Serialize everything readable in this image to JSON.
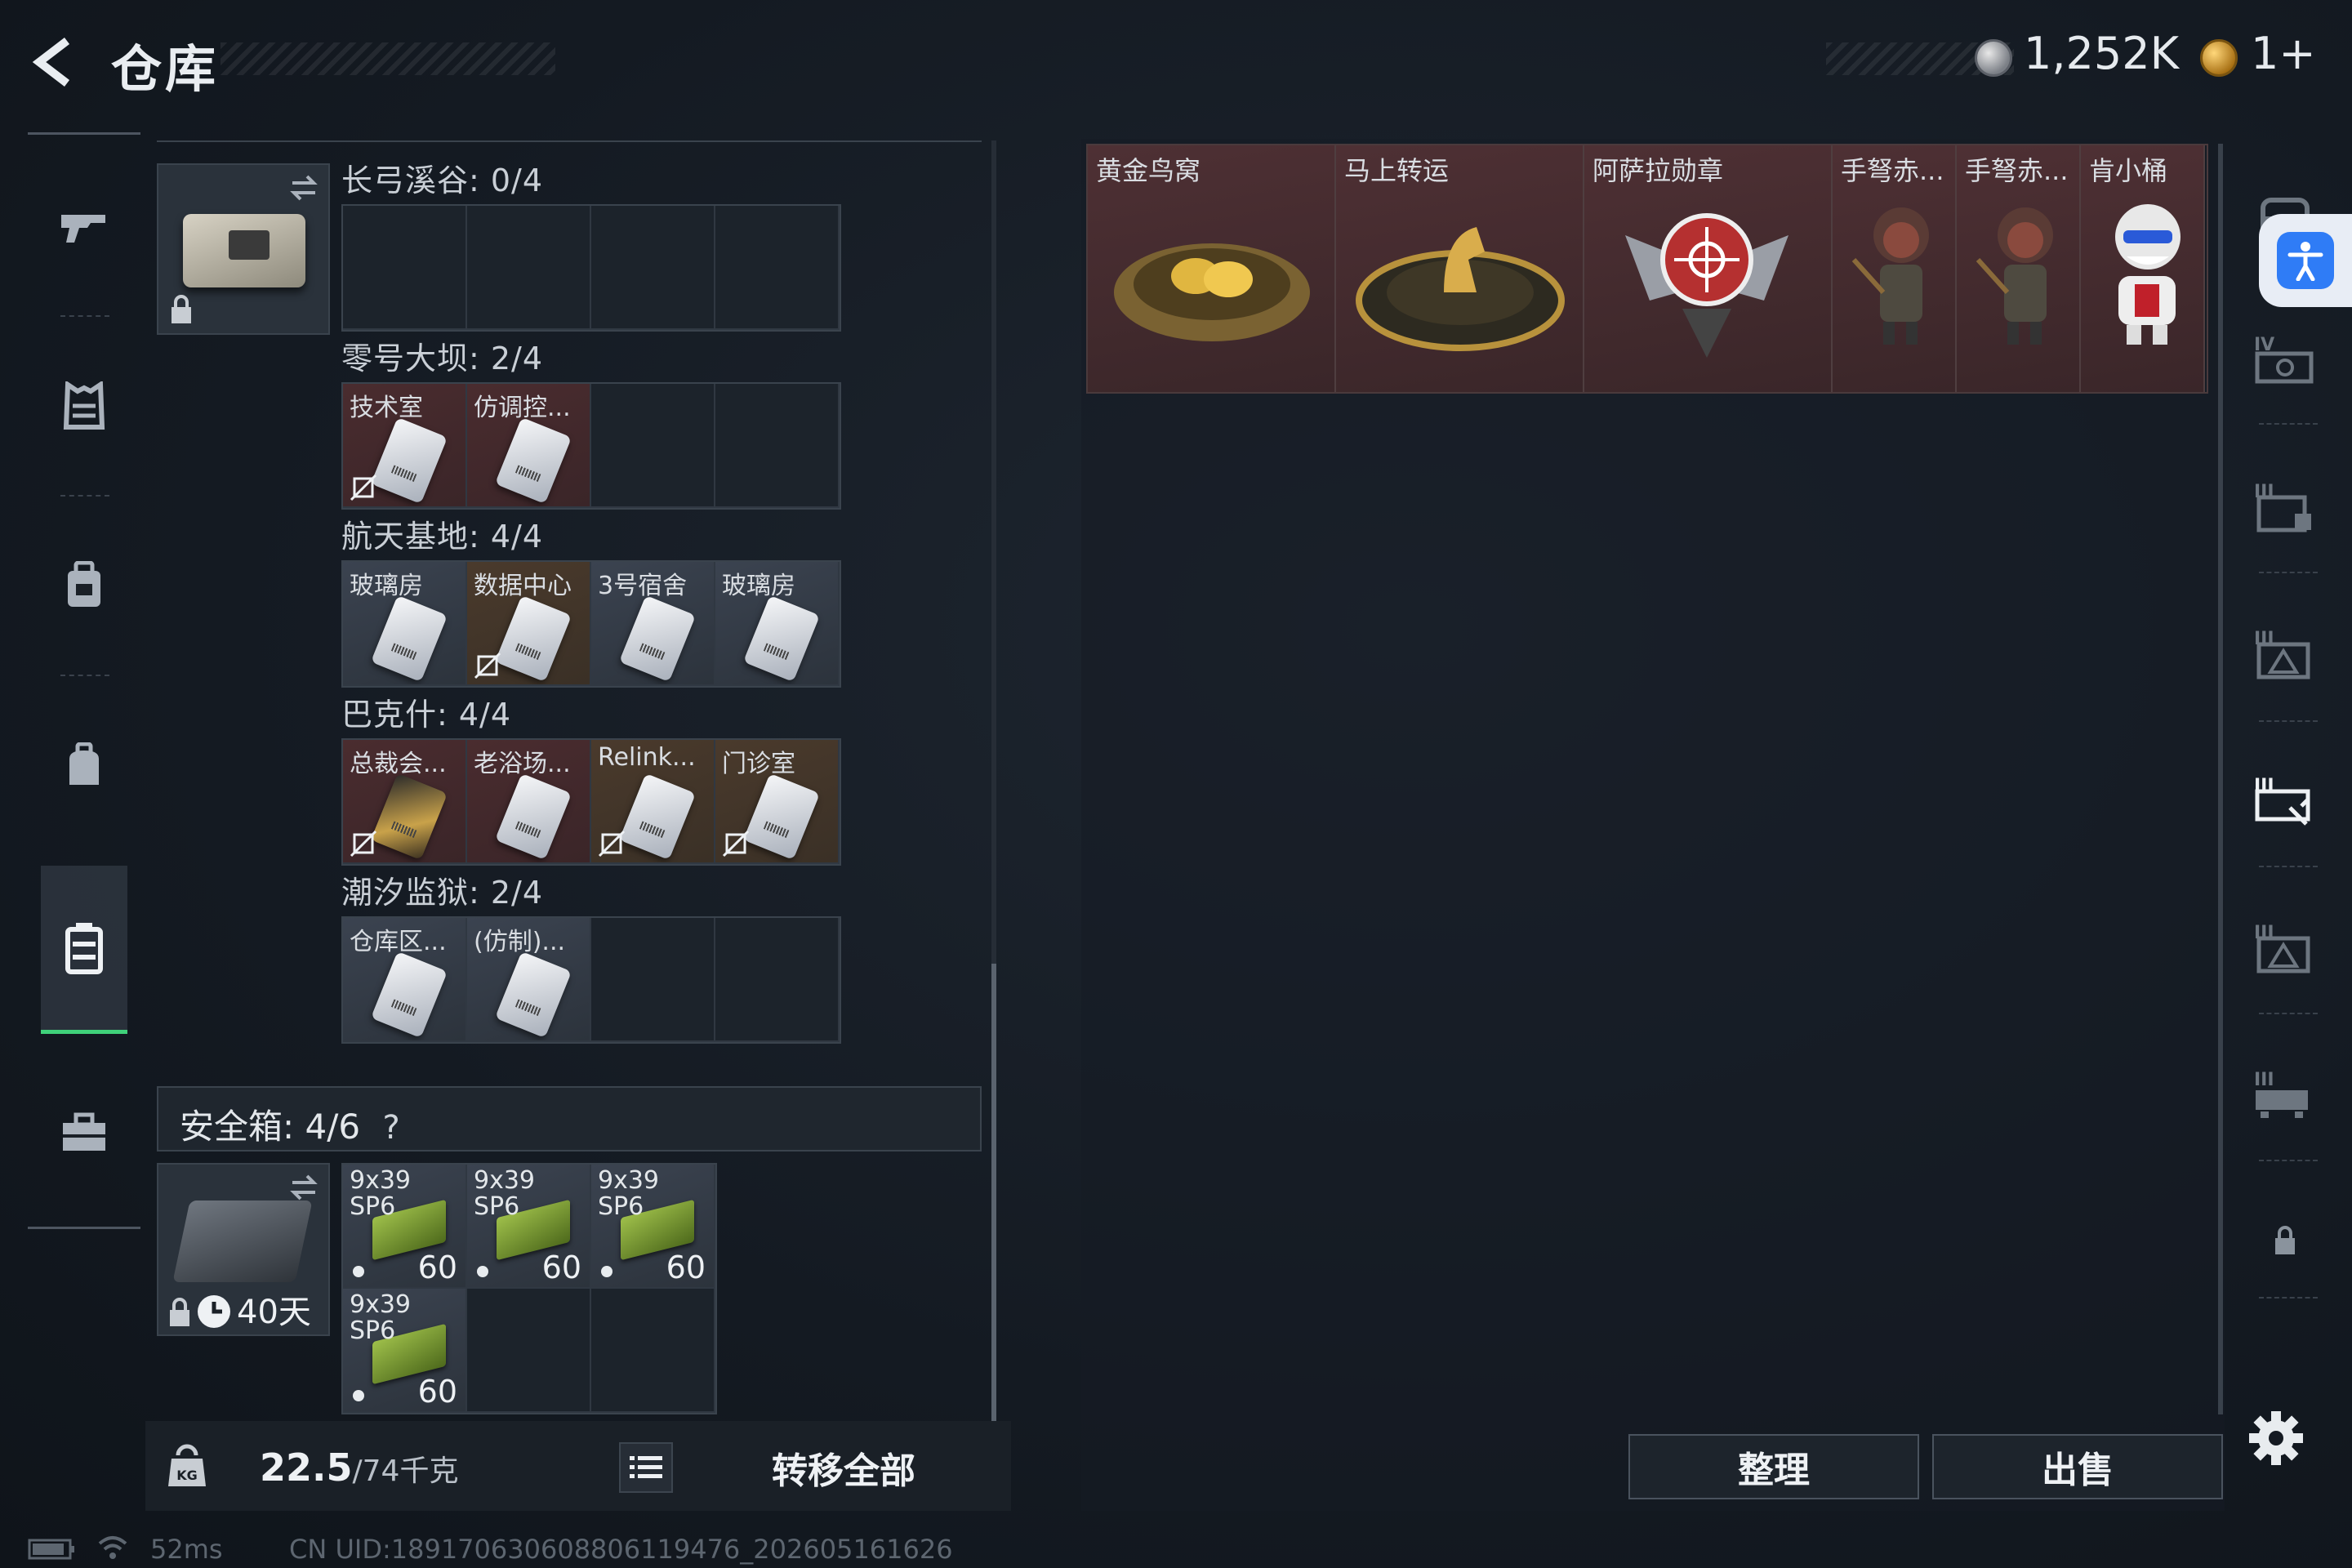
{
  "header": {
    "title": "仓库",
    "silver_amount": "1,252K",
    "gold_amount": "1+"
  },
  "left_nav": {
    "items": [
      "gun-icon",
      "armor-icon",
      "backpack-icon",
      "bag-icon",
      "stash-icon",
      "toolbox-icon"
    ]
  },
  "keycard_holder": {
    "sections": [
      {
        "label": "长弓溪谷: 0/4",
        "cells": []
      },
      {
        "label": "零号大坝: 2/4",
        "cells": [
          {
            "name": "技术室",
            "nosell": true,
            "tone": "red"
          },
          {
            "name": "仿调控...",
            "nosell": false,
            "tone": "red"
          }
        ]
      },
      {
        "label": "航天基地: 4/4",
        "cells": [
          {
            "name": "玻璃房",
            "nosell": false,
            "tone": "grey"
          },
          {
            "name": "数据中心",
            "nosell": true,
            "tone": "gold"
          },
          {
            "name": "3号宿舍",
            "nosell": false,
            "tone": "grey"
          },
          {
            "name": "玻璃房",
            "nosell": false,
            "tone": "grey"
          }
        ]
      },
      {
        "label": "巴克什: 4/4",
        "cells": [
          {
            "name": "总裁会...",
            "nosell": true,
            "tone": "red",
            "gold": true
          },
          {
            "name": "老浴场...",
            "nosell": false,
            "tone": "red"
          },
          {
            "name": "Relink...",
            "nosell": true,
            "tone": "gold"
          },
          {
            "name": "门诊室",
            "nosell": true,
            "tone": "gold"
          }
        ]
      },
      {
        "label": "潮汐监狱: 2/4",
        "cells": [
          {
            "name": "仓库区...",
            "nosell": false,
            "tone": "grey"
          },
          {
            "name": "(仿制)...",
            "nosell": false,
            "tone": "grey"
          }
        ]
      }
    ]
  },
  "safebox": {
    "label": "安全箱: 4/6",
    "help": "?",
    "timer": "40天",
    "ammo": [
      {
        "name": "9x39 SP6",
        "count": "60"
      },
      {
        "name": "9x39 SP6",
        "count": "60"
      },
      {
        "name": "9x39 SP6",
        "count": "60"
      },
      {
        "name": "9x39 SP6",
        "count": "60"
      }
    ]
  },
  "bottom": {
    "weight": "22.5",
    "weight_max": "/74千克",
    "transfer_all": "转移全部"
  },
  "status": {
    "ping": "52ms",
    "uid": "CN UID:18917063060880611​9476_202605161626"
  },
  "stash": {
    "items": [
      {
        "name": "黄金鸟窝"
      },
      {
        "name": "马上转运"
      },
      {
        "name": "阿萨拉勋章"
      },
      {
        "name": "手弩赤..."
      },
      {
        "name": "手弩赤..."
      },
      {
        "name": "肯小桶"
      }
    ]
  },
  "actions": {
    "organize": "整理",
    "sell": "出售"
  },
  "colors": {
    "accent_green": "#3fd17a",
    "access_blue": "#2f7cf6"
  }
}
